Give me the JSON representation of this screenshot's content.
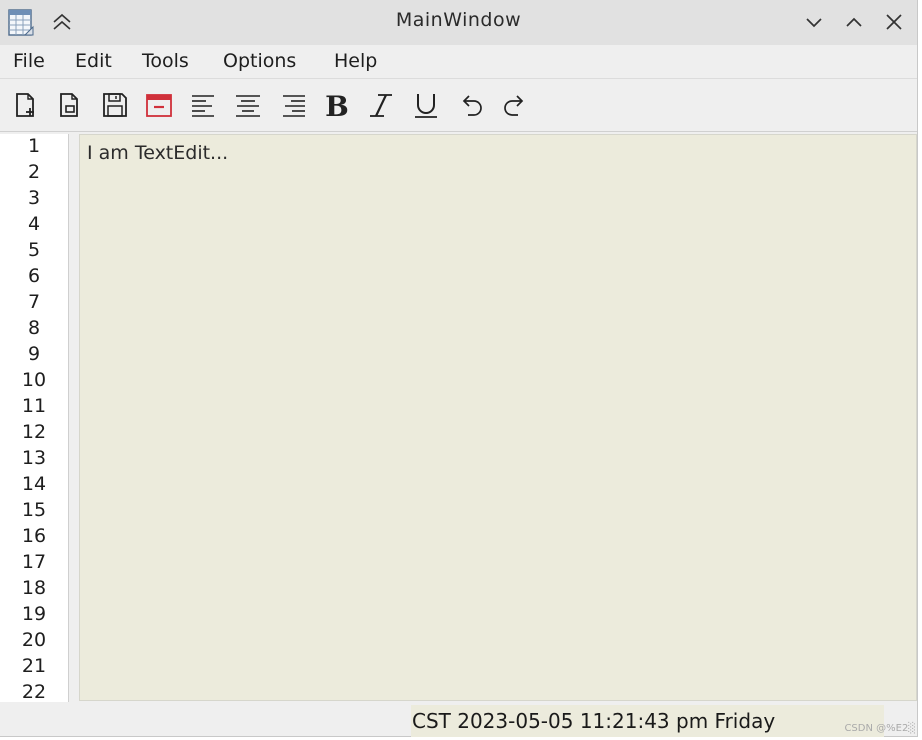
{
  "window": {
    "title": "MainWindow"
  },
  "menu": [
    "File",
    "Edit",
    "Tools",
    "Options",
    "Help"
  ],
  "toolbar": {
    "tools": [
      "new-file-icon",
      "open-file-icon",
      "save-icon",
      "close-doc-icon",
      "align-left-icon",
      "align-center-icon",
      "align-right-icon",
      "bold-icon",
      "italic-icon",
      "underline-icon",
      "undo-icon",
      "redo-icon"
    ]
  },
  "line_numbers": [
    "1",
    "2",
    "3",
    "4",
    "5",
    "6",
    "7",
    "8",
    "9",
    "10",
    "11",
    "12",
    "13",
    "14",
    "15",
    "16",
    "17",
    "18",
    "19",
    "20",
    "21",
    "22"
  ],
  "editor": {
    "text": "I am TextEdit...",
    "background": "#ecebdc"
  },
  "status": {
    "clock": "CST 2023-05-05 11:21:43 pm Friday"
  },
  "watermark": "CSDN @%E2░"
}
